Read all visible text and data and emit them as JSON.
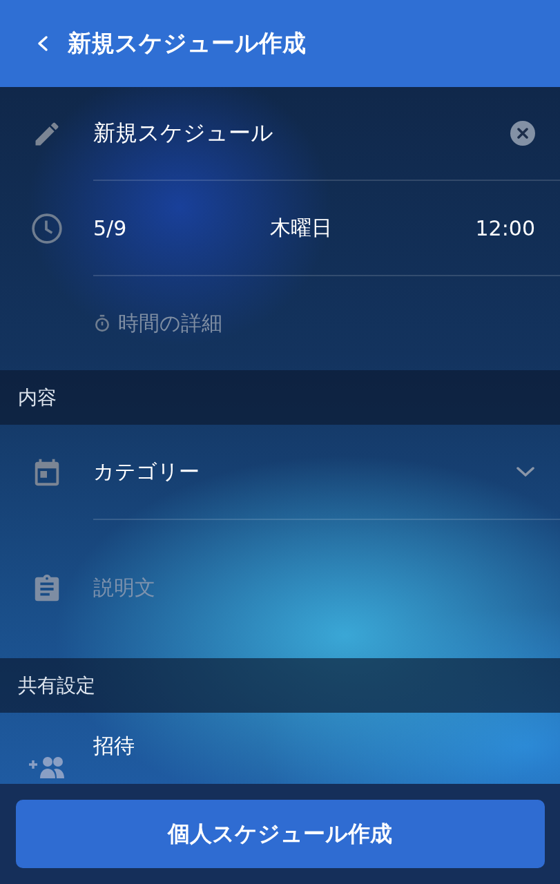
{
  "header": {
    "title": "新規スケジュール作成"
  },
  "title_field": {
    "value": "新規スケジュール"
  },
  "datetime": {
    "date": "5/9",
    "weekday": "木曜日",
    "time": "12:00"
  },
  "time_detail": {
    "label": "時間の詳細"
  },
  "sections": [
    {
      "heading": "内容",
      "rows": [
        {
          "kind": "dropdown",
          "label": "カテゴリー"
        },
        {
          "kind": "textarea",
          "placeholder": "説明文"
        }
      ]
    },
    {
      "heading": "共有設定",
      "rows": [
        {
          "kind": "invite",
          "label": "招待"
        }
      ]
    }
  ],
  "submit_button": {
    "label": "個人スケジュール作成"
  }
}
